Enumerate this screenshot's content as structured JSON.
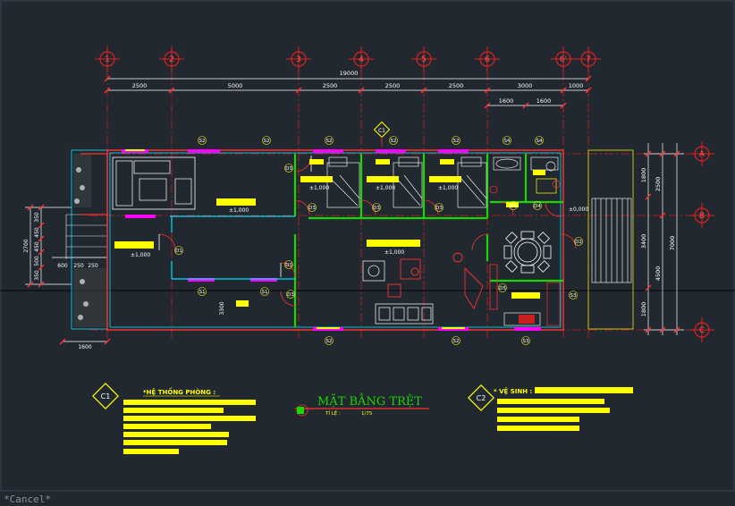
{
  "drawing": {
    "title": "MẶT BẰNG TRỆT",
    "scale_label": "TỈ LỆ :",
    "scale_value": "1/75"
  },
  "grid_axes": {
    "vertical": [
      "1",
      "2",
      "3",
      "4",
      "5",
      "6",
      "6'",
      "7"
    ],
    "horizontal": [
      "A",
      "B",
      "C"
    ]
  },
  "dimensions": {
    "overall_top": "19000",
    "top_segments": [
      "2500",
      "5000",
      "2500",
      "2500",
      "2500",
      "3000",
      "1000"
    ],
    "top_sub": [
      "1600",
      "1600"
    ],
    "right_inner": [
      "1800",
      "3400",
      "1800"
    ],
    "right_mid": [
      "2500",
      "4500"
    ],
    "right_outer": "7000",
    "left_outer": "2700",
    "left_small": [
      "350",
      "450",
      "450",
      "500",
      "350",
      "250"
    ],
    "left_stair": [
      "600",
      "250",
      "250"
    ],
    "bottom_left": "1600",
    "interior_v": "3300"
  },
  "labels": {
    "windows": [
      "S2",
      "S2",
      "S2",
      "S2",
      "S2",
      "S4",
      "S4",
      "S1",
      "S1",
      "S2",
      "S2",
      "S3",
      "S3"
    ],
    "doors": [
      "D1",
      "D2",
      "D3",
      "D3",
      "D3",
      "D3",
      "D3",
      "D3",
      "D4",
      "D4",
      "D5"
    ],
    "levels": [
      "±1,000",
      "±1,000",
      "±1,000",
      "±1,000",
      "±1,000",
      "±1,000",
      "±0,000"
    ],
    "symbol_top": "C1"
  },
  "notes": {
    "left_marker": "C1",
    "left_heading": "*HỆ THỐNG PHÒNG :",
    "right_marker": "C2",
    "right_heading": "* VỆ SINH :"
  },
  "command": {
    "text": "*Cancel*"
  },
  "colors": {
    "background": "#212830",
    "grid_line": "#c81e1e",
    "wall": "#19d600",
    "dimension": "#ffffff",
    "highlight": "#ffff00",
    "cyan": "#00e0ff",
    "magenta": "#ff00ff"
  }
}
